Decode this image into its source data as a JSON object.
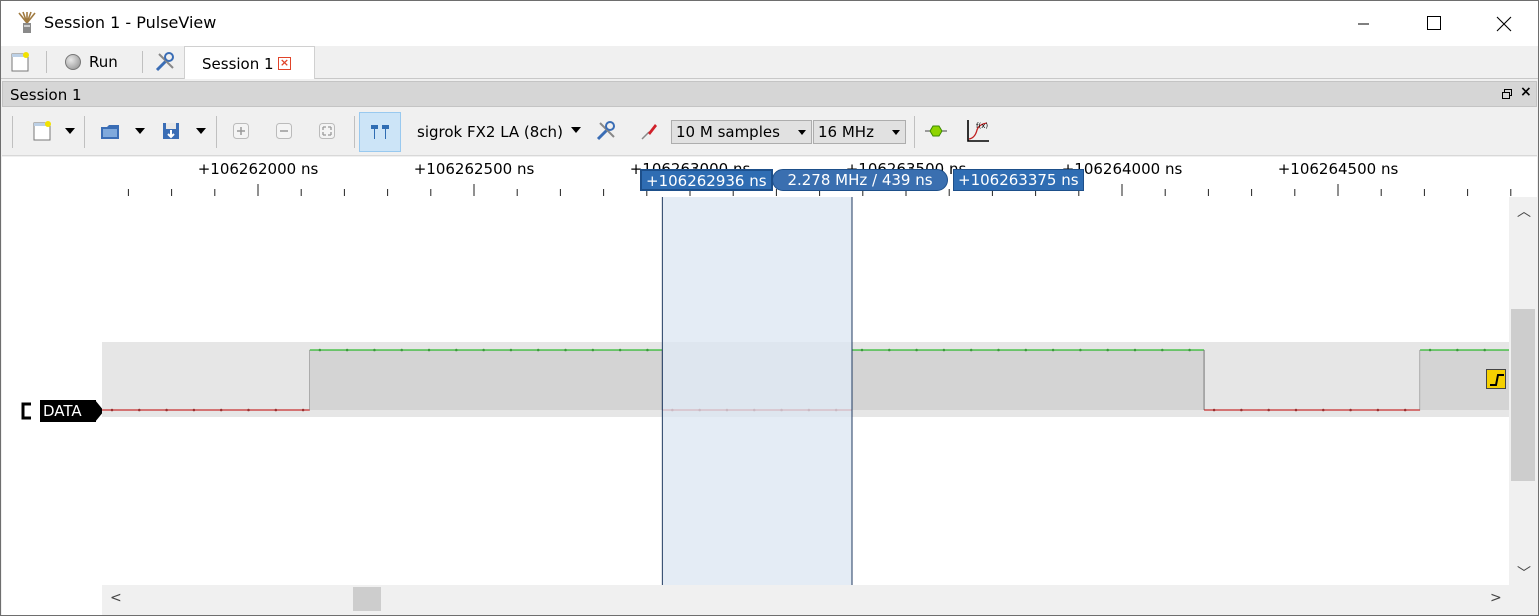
{
  "window": {
    "title": "Session 1 - PulseView"
  },
  "tabbar": {
    "run_label": "Run",
    "session_tab_label": "Session 1"
  },
  "dock": {
    "title": "Session 1"
  },
  "toolbar": {
    "device": "sigrok FX2 LA (8ch)",
    "samples": "10 M samples",
    "samplerate": "16 MHz"
  },
  "ruler": {
    "ticks": [
      {
        "label": "+106262000 ns",
        "value": 106262000
      },
      {
        "label": "+106262500 ns",
        "value": 106262500
      },
      {
        "label": "+106263000 ns",
        "value": 106263000
      },
      {
        "label": "+106263500 ns",
        "value": 106263500
      },
      {
        "label": "+106264000 ns",
        "value": 106264000
      },
      {
        "label": "+106264500 ns",
        "value": 106264500
      }
    ]
  },
  "cursors": {
    "left_label": "+106262936 ns",
    "left_value": 106262936,
    "right_label": "+106263375 ns",
    "right_value": 106263375,
    "delta_label": "2.278 MHz / 439 ns"
  },
  "channel": {
    "name": "DATA",
    "high_color": "#00b000",
    "low_color": "#c00000",
    "transitions_ns": [
      106262120,
      106262936,
      106263375,
      106264190,
      106264690
    ],
    "initial_level": 0
  },
  "colors": {
    "cursor_fill": "#dbe6f2",
    "selection_accent": "#2f6db3",
    "trigger": "#f5d000"
  }
}
